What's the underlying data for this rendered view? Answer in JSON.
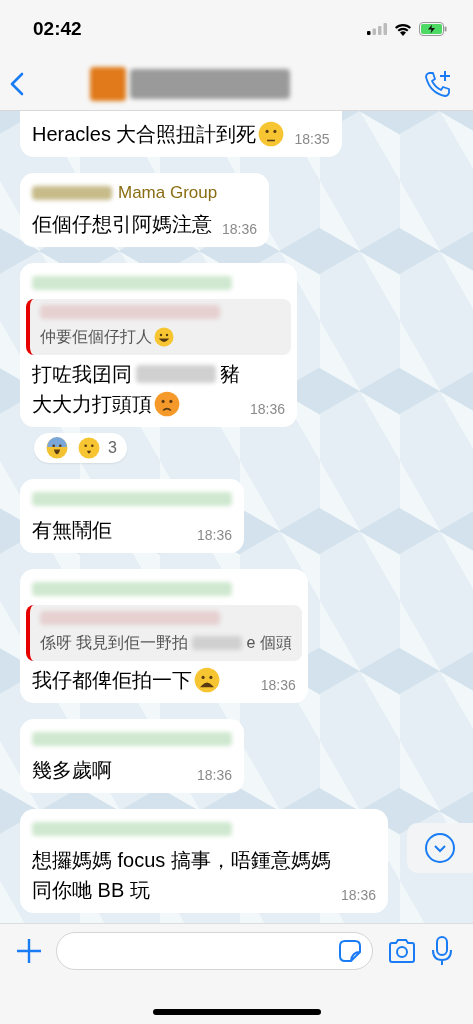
{
  "status_bar": {
    "time": "02:42"
  },
  "messages": [
    {
      "time": "18:35",
      "lines": [
        [
          {
            "kind": "text",
            "t": "Heracles 大合照扭計到死"
          },
          {
            "kind": "skeptical"
          }
        ]
      ]
    },
    {
      "sender_hidden": true,
      "sender": "Mama Group",
      "time": "18:36",
      "lines": [
        [
          {
            "kind": "text",
            "t": "佢個仔想引阿媽注意"
          }
        ]
      ]
    },
    {
      "sender_hidden": true,
      "time": "18:36",
      "quote": {
        "lines": [
          [
            {
              "kind": "text",
              "t": "仲要佢個仔打人"
            },
            {
              "kind": "sweatsmile"
            }
          ]
        ]
      },
      "lines": [
        [
          {
            "kind": "text",
            "t": "打咗我囝同"
          },
          {
            "kind": "redacted"
          },
          {
            "kind": "text",
            "t": "豬"
          }
        ],
        [
          {
            "kind": "text",
            "t": "大大力打頭頂"
          },
          {
            "kind": "angry"
          }
        ]
      ],
      "reactions": {
        "emojis": [
          {
            "kind": "scream"
          },
          {
            "kind": "surprised"
          }
        ],
        "count": "3"
      }
    },
    {
      "sender_hidden": true,
      "time": "18:36",
      "lines": [
        [
          {
            "kind": "text",
            "t": "有無鬧佢"
          }
        ]
      ]
    },
    {
      "sender_hidden": true,
      "time": "18:36",
      "quote": {
        "lines": [
          [
            {
              "kind": "text",
              "t": "係呀 我見到佢一野拍"
            },
            {
              "kind": "redacted"
            },
            {
              "kind": "text",
              "t": "e 個頭"
            }
          ]
        ]
      },
      "lines": [
        [
          {
            "kind": "text",
            "t": "我仔都俾佢拍一下"
          },
          {
            "kind": "tired"
          }
        ]
      ]
    },
    {
      "sender_hidden": true,
      "time": "18:36",
      "lines": [
        [
          {
            "kind": "text",
            "t": "幾多歲啊"
          }
        ]
      ]
    },
    {
      "sender_hidden": true,
      "time": "18:36",
      "lines": [
        [
          {
            "kind": "text",
            "t": "想攞媽媽 focus 搞事，唔鍾意媽媽"
          }
        ],
        [
          {
            "kind": "text",
            "t": "同你哋 BB 玩"
          }
        ]
      ]
    }
  ]
}
